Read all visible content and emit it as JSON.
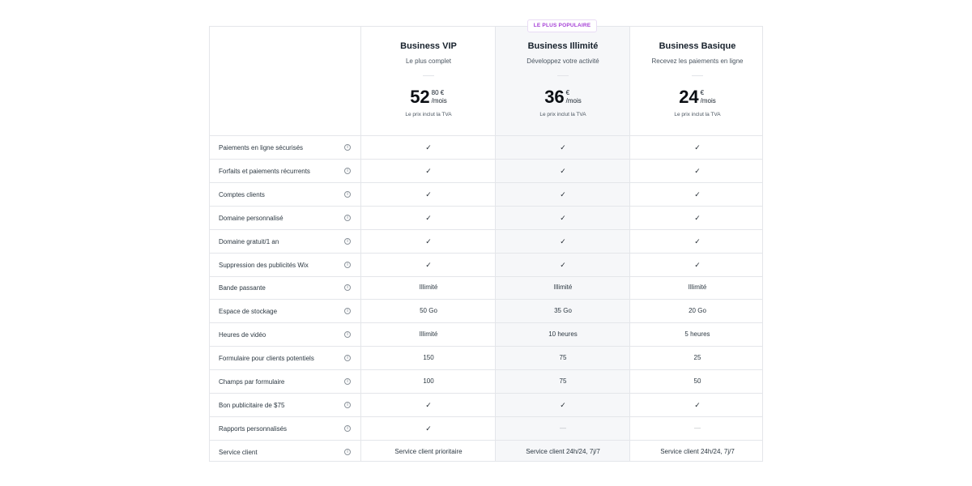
{
  "badge": "LE PLUS POPULAIRE",
  "plans": [
    {
      "name": "Business VIP",
      "desc": "Le plus complet",
      "price_int": "52",
      "price_dec": "80 €",
      "per": "/mois",
      "vat": "Le prix inclut la TVA"
    },
    {
      "name": "Business Illimité",
      "desc": "Développez votre activité",
      "price_int": "36",
      "price_dec": "€",
      "per": "/mois",
      "vat": "Le prix inclut la TVA"
    },
    {
      "name": "Business Basique",
      "desc": "Recevez les paiements en ligne",
      "price_int": "24",
      "price_dec": "€",
      "per": "/mois",
      "vat": "Le prix inclut la TVA"
    }
  ],
  "info_glyph": "i",
  "features": [
    {
      "label": "Paiements en ligne sécurisés",
      "values": [
        "✓",
        "✓",
        "✓"
      ]
    },
    {
      "label": "Forfaits et paiements récurrents",
      "values": [
        "✓",
        "✓",
        "✓"
      ]
    },
    {
      "label": "Comptes clients",
      "values": [
        "✓",
        "✓",
        "✓"
      ]
    },
    {
      "label": "Domaine personnalisé",
      "values": [
        "✓",
        "✓",
        "✓"
      ]
    },
    {
      "label": "Domaine gratuit/1 an",
      "values": [
        "✓",
        "✓",
        "✓"
      ]
    },
    {
      "label": "Suppression des publicités Wix",
      "values": [
        "✓",
        "✓",
        "✓"
      ]
    },
    {
      "label": "Bande passante",
      "values": [
        "Illimité",
        "Illimité",
        "Illimité"
      ]
    },
    {
      "label": "Espace de stockage",
      "values": [
        "50 Go",
        "35 Go",
        "20 Go"
      ]
    },
    {
      "label": "Heures de vidéo",
      "values": [
        "Illimité",
        "10 heures",
        "5 heures"
      ]
    },
    {
      "label": "Formulaire pour clients potentiels",
      "values": [
        "150",
        "75",
        "25"
      ]
    },
    {
      "label": "Champs par formulaire",
      "values": [
        "100",
        "75",
        "50"
      ]
    },
    {
      "label": "Bon publicitaire de $75",
      "values": [
        "✓",
        "✓",
        "✓"
      ]
    },
    {
      "label": "Rapports personnalisés",
      "values": [
        "✓",
        "—",
        "—"
      ]
    },
    {
      "label": "Service client",
      "values": [
        "Service client prioritaire",
        "Service client 24h/24, 7j/7",
        "Service client 24h/24, 7j/7"
      ]
    }
  ],
  "colors": {
    "accent": "#a53ed6",
    "highlight_bg": "#f6f7f9",
    "border": "#e4e6ea"
  }
}
